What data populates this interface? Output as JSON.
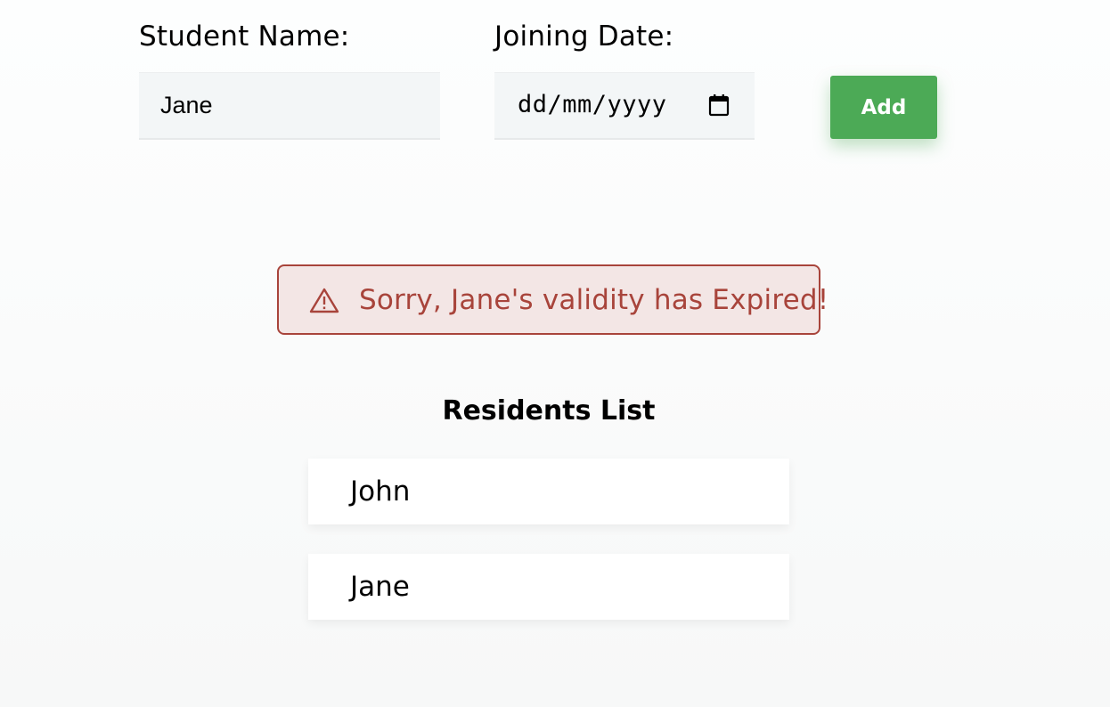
{
  "form": {
    "name_label": "Student Name:",
    "name_value": "Jane",
    "date_label": "Joining Date:",
    "date_placeholder": "dd/mm/yyyy",
    "add_label": "Add"
  },
  "alert": {
    "message": "Sorry, Jane's validity has Expired!",
    "color": "#a8443b",
    "background": "#f3e6e5"
  },
  "residents": {
    "heading": "Residents List",
    "items": [
      {
        "name": "John"
      },
      {
        "name": "Jane"
      }
    ]
  },
  "colors": {
    "accent": "#4caa56"
  },
  "icons": {
    "calendar": "calendar-icon",
    "warning": "warning-triangle-icon"
  }
}
